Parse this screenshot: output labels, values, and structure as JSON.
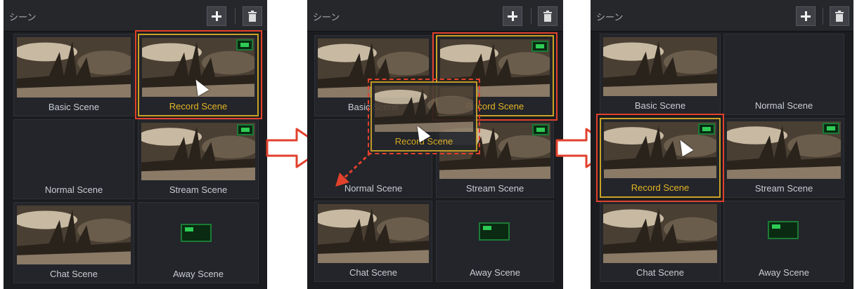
{
  "panels": [
    {
      "title": "シーン",
      "scenes": [
        "Basic Scene",
        "Record Scene",
        "Normal Scene",
        "Stream Scene",
        "Chat Scene",
        "Away Scene"
      ]
    },
    {
      "title": "シーン",
      "scenes": [
        "Basic Scene",
        "Record Scene",
        "Normal Scene",
        "Stream Scene",
        "Chat Scene",
        "Away Scene"
      ],
      "drag_label": "Record Scene"
    },
    {
      "title": "シーン",
      "scenes": [
        "Basic Scene",
        "Normal Scene",
        "Record Scene",
        "Stream Scene",
        "Chat Scene",
        "Away Scene"
      ]
    }
  ],
  "icons": {
    "add": "plus-icon",
    "delete": "trash-icon",
    "live": "live-monitor-icon",
    "cursor": "mouse-pointer-icon",
    "step_arrow": "right-arrow-icon"
  },
  "colors": {
    "panel_bg": "#1b1c1f",
    "selected_border": "#c9a227",
    "selected_text": "#e4b423",
    "highlight": "#e2412c",
    "live_green": "#2ecc55"
  }
}
